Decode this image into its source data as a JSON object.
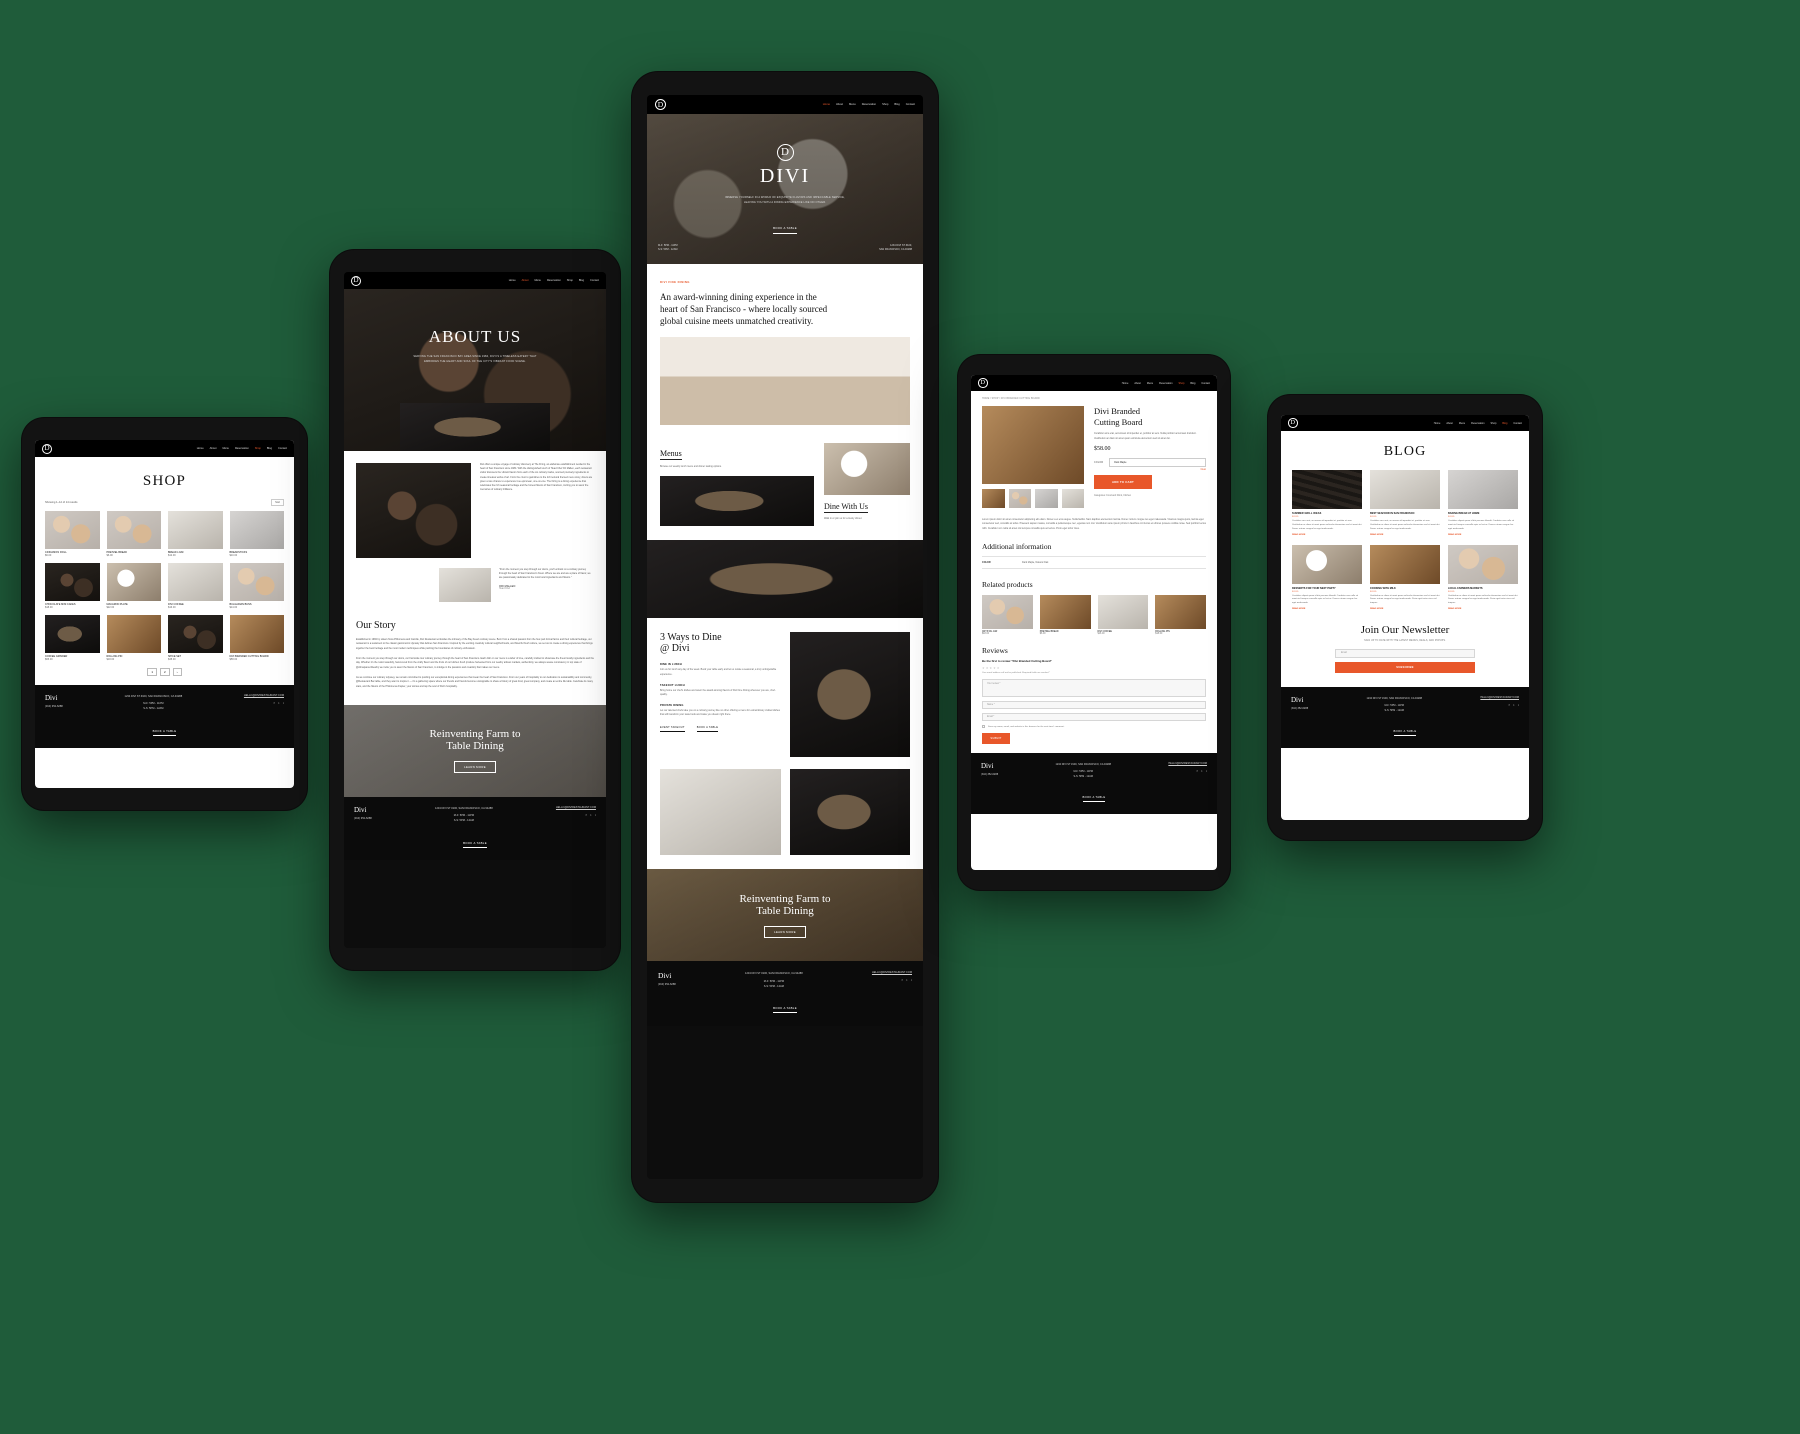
{
  "brand": {
    "name": "Divi",
    "logo_letter": "D"
  },
  "nav": {
    "items": [
      "Home",
      "About",
      "Menu",
      "Reservation",
      "Shop",
      "Blog",
      "Contact"
    ],
    "shop_caret": "Shop",
    "accent_color": "#e8572a"
  },
  "footer": {
    "brand": "Divi",
    "phone": "(310) 352-6288",
    "address": "1234 DIVI ST #100, SAN FRANCISCO, CA 94288",
    "hours_week": "M-F: 5PM - 11PM",
    "hours_weekend": "S-S: 5PM - 12AM",
    "email": "HELLO@DIVIRESTAURANT.COM",
    "book_label": "BOOK A TABLE",
    "socials": [
      "f",
      "t",
      "i"
    ]
  },
  "device_shop": {
    "page_title": "SHOP",
    "results_text": "Showing 1–12 of 14 results",
    "sort_label": "Sort",
    "products": [
      {
        "name": "CINNAMON ROLL",
        "price": "$6.00",
        "img": "ph-bread"
      },
      {
        "name": "PRETZEL BREAD",
        "price": "$6.00",
        "img": "ph-bread"
      },
      {
        "name": "BREAD LOAF",
        "price": "$12.00",
        "img": "ph-napkin"
      },
      {
        "name": "BREADSTICKS",
        "price": "$10.00",
        "img": "ph-stone"
      },
      {
        "name": "CHOCOLATE MINI CAKES",
        "price": "$18.00",
        "img": "ph-dark"
      },
      {
        "name": "MACARON PLATE",
        "price": "$22.00",
        "img": "ph-cream"
      },
      {
        "name": "DIVI COFFEE",
        "price": "$16.00",
        "img": "ph-napkin"
      },
      {
        "name": "BULGARIAN BUNS",
        "price": "$14.00",
        "img": "ph-bread"
      },
      {
        "name": "COFFEE GRINDER",
        "price": "$65.00",
        "img": "ph-pan"
      },
      {
        "name": "ROLLING PIN",
        "price": "$18.00",
        "img": "ph-wood"
      },
      {
        "name": "SPICE SET",
        "price": "$38.00",
        "img": "ph-dark"
      },
      {
        "name": "DIVI BRANDED CUTTING BOARD",
        "price": "$58.00",
        "img": "ph-wood"
      }
    ],
    "pagination": [
      "1",
      "2",
      "›"
    ]
  },
  "device_about": {
    "hero_title": "ABOUT US",
    "hero_sub_1": "SERVING THE SAN FRANCISCO BAY AREA SINCE 1984, DIVI IS A TIMELESS EATERY THAT",
    "hero_sub_2": "EMBODIES THE HEART AND SOUL OF THE CITY'S VIBRANT FOOD SCENE.",
    "intro_paragraph": "Divi offers a unique voyage of culinary discovery at The Firing, an elaborate establishment nestled in the heart of San Francisco since 1984. With the distinguished touch of Head Chef Ori Mallen, each restaurant visitor discovers the vibrant flavors from each of the six culinary tracks, sourced precisely ingredients to create timeless works of art. From the crust to garnishes to the rich textural themed menu story, diners are given a rare chance to experience true epicurean, one-on-one. The Firing is a dining experience that celebrates the rich seasonal heritage and the honest flavors of San Francisco, inviting you to savor the memories of culinary brilliance.",
    "quote": "\"From the moment you step through our doors, you'll embark on a culinary journey through the heart of San Francisco's finest. Where we are and are a place of flavor, we are passionately dedicated to the most local ingredients and flavors.\"",
    "quote_author": "ORI MALLEN",
    "quote_role": "Head Chef",
    "story_heading": "Our Story",
    "story_p1": "Established in 1984 by sisters Nora Philomena and Camille, Divi Restaurant embodies the intimacy of the Bay Area's culinary scene. Born from a shared passion from the four-part formal farms and their cultural heritage, our restaurant is a testament to the classic gastronomic dynasty that defines San Francisco. Inspired by the exciting creativity cultural neighborhoods, and flavorful fresh culture, we set out to create a dining experience that brings together the best heritage and the most modern techniques while pushing the boundaries of culinary enthusiasm.",
    "story_p2": "From the moment you step through our doors, our Farmside tour culinary journey through the heart of San Francisco. Each dish on our menu is a labor of love, carefully crafted to showcase the finest locally ingredients and the day. Whether it's the rustic tastefully, hand-cured from the crafty flavor and the fruits of our kitchen fresh produce harvested from our nearby artisan markets, authenticity, we always weave consistency in top state of @AlmaparoenNearby we invite you to savor the flavors of San Francisco, to indulge in the passions and creativity that makes our menu.",
    "story_p3": "As we continue our culinary odyssey, we remain committed to pushing our exceptional dining experiences that mean the heart of San Francisco. From our years of hospitality to our dedication to sustainability and community, @Restaurant Bar table, and they want to inspire it — it's a gathering space where our friends and friends become unstoppable to share a history of great food, great company, and create an entire life table. Celebrate its many stars, and the flavors of the Philomena chapter, your stories and tap the soul of Divi's hospitality.",
    "cta_title_l1": "Reinventing Farm to",
    "cta_title_l2": "Table Dining",
    "cta_button": "LEARN MORE"
  },
  "device_home": {
    "hero_logo_letter": "D",
    "hero_title": "DIVI",
    "hero_sub_1": "IMMERSE YOURSELF IN A WORLD OF EXQUISITE FLAVORS AND IMPECCABLE SERVICE,",
    "hero_sub_2": "LEAVING YOU WITH A DINING EXPERIENCE LIKE NO OTHER.",
    "hero_cta": "BOOK A TABLE",
    "hero_hours_1": "M-F: 5PM - 11PM",
    "hero_hours_2": "S-S: 5PM - 12AM",
    "hero_addr_1": "1234 DIVI ST #100,",
    "hero_addr_2": "SAN FRANCISCO, CA 94288",
    "eyebrow": "DIVI FINE DINING",
    "headline_l1": "An award-winning dining experience in the",
    "headline_l2": "heart of San Francisco - where locally sourced",
    "headline_l3": "global cuisine meets unmatched creativity.",
    "menus_heading": "Menus",
    "menus_sub": "Browse our weekly lunch menu and dinner tasting options.",
    "dine_heading": "Dine With Us",
    "dine_sub": "Walk in or join us for a lovely dinner.",
    "ways_heading_l1": "3 Ways to Dine",
    "ways_heading_l2": "@ Divi",
    "ways": [
      {
        "title": "DINE IN LUNCH",
        "body": "Join us for lunch any day of the week. Book your table early and let us curate a seasonal, a truly unforgettable experience."
      },
      {
        "title": "TAKEOUT LUNCH",
        "body": "Bring home our chef's dishes and savor the award-winning flavors of Divi Fine Dining wherever you are, chef-quality."
      },
      {
        "title": "PRIVATE DINING",
        "body": "Let our talented chefs take you on a culinary journey like no other offering a menu for extraordinary crafted dishes that will transform your taste buds and make you dream right there."
      }
    ],
    "ways_btn_1": "EVENT TAKEOUT",
    "ways_btn_2": "BOOK A TABLE",
    "cta_title_l1": "Reinventing Farm to",
    "cta_title_l2": "Table Dining",
    "cta_button": "LEARN MORE"
  },
  "device_product": {
    "breadcrumb": "HOME / SHOP / DIVI BRANDED CUTTING BOARD",
    "title_l1": "Divi Branded",
    "title_l2": "Cutting Board",
    "description": "Curabitur arcu erat, accumsan id imperdiet et, porttitor at sem. Nulla porttitor accumsan tincidunt. Vestibulum ac diam sit amet quam vehicula elementum sed sit amet dui.",
    "price": "$58.00",
    "price_currency": "$",
    "color_label": "COLOR",
    "color_value": "Dark Maple",
    "clear_label": "Clear",
    "add_to_cart": "ADD TO CART",
    "meta": "Categories: Food and Drink, Kitchen",
    "long_description": "Lorem ipsum dolor sit amet consectetur adipiscing elit etiam. Donec a et eros augue. Nulla facilisi. Nam dapibus elementum lacinia. Donec rutrum congue leo eget malesuada. Vivamus magna justo, lacinia eget consectetur sed, convallis at tellus. Praesent sapien massa, convallis a pellentesque nec, egestas non nisi. Vestibulum ante ipsum primis in faucibus orci luctus et ultrices posuere cubilia curae. Sed porttitor lectus nibh. Curabitur non nulla sit amet nisl tempus convallis quis ac lectus. Proin eget tortor risus.",
    "addl_heading": "Additional information",
    "addl_rows": [
      {
        "label": "COLOR",
        "value": "Dark Maple, Natural Oak"
      }
    ],
    "related_heading": "Related products",
    "related": [
      {
        "name": "CRYSTAL JAR",
        "price": "$18.00",
        "img": "ph-bread"
      },
      {
        "name": "PRETZEL BREAD",
        "price": "$6.00",
        "img": "ph-wood"
      },
      {
        "name": "DIVI COFFEE",
        "price": "$16.00",
        "img": "ph-napkin"
      },
      {
        "name": "ROLLING PIN",
        "price": "$18.00",
        "img": "ph-wood"
      }
    ],
    "reviews_heading": "Reviews",
    "reviews_sub": "Be the first to review \"Divi Branded Cutting Board\"",
    "reviews_note": "Your email address will not be published. Required fields are marked *",
    "field_review": "Your review *",
    "field_name": "Name *",
    "field_email": "Email *",
    "save_checkbox": "Save my name, email, and website in this browser for the next time I comment.",
    "submit_label": "SUBMIT",
    "thumbs": [
      "ph-wood",
      "ph-bread",
      "ph-stone",
      "ph-napkin"
    ]
  },
  "device_blog": {
    "page_title": "BLOG",
    "posts": [
      {
        "title": "SUMMER GRILL IDEAS",
        "cat": "FOOD",
        "body": "Curabitur arcu erat, accumsan id imperdiet et, porttitor at sem. Vestibulum ac diam sit amet quam vehicula elementum sed sit amet dui. Donec rutrum congue leo eget malesuada.",
        "more": "READ MORE",
        "img": "ph-grill"
      },
      {
        "title": "BEST SEAFOOD IN SAN FRANCISCO",
        "cat": "FOOD",
        "body": "Curabitur arcu erat, accumsan id imperdiet et, porttitor at sem. Vestibulum ac diam sit amet quam vehicula elementum sed sit amet dui. Donec rutrum congue leo eget malesuada.",
        "more": "READ MORE",
        "img": "ph-napkin"
      },
      {
        "title": "BAKING BREAD AT HOME",
        "cat": "FOOD",
        "body": "Curabitur aliquet quam id dui posuere blandit. Curabitur non nulla sit amet nisl tempus convallis quis ac lectus. Donec rutrum congue leo eget malesuada.",
        "more": "READ MORE",
        "img": "ph-stone"
      },
      {
        "title": "DESSERTS FOR YOUR NEXT PARTY",
        "cat": "FOOD",
        "body": "Curabitur aliquet quam id dui posuere blandit. Curabitur non nulla sit amet nisl tempus convallis quis ac lectus. Donec rutrum congue leo eget malesuada.",
        "more": "READ MORE",
        "img": "ph-cream"
      },
      {
        "title": "COOKING WITH MILK",
        "cat": "FOOD",
        "body": "Vestibulum ac diam sit amet quam vehicula elementum sed sit amet dui. Donec rutrum congue leo eget malesuada. Proin eget tortor risus nisl tempus.",
        "more": "READ MORE",
        "img": "ph-bread"
      },
      {
        "title": "LOCAL FARMERS MARKETS",
        "cat": "FOOD",
        "body": "Vestibulum ac diam sit amet quam vehicula elementum sed sit amet dui. Donec rutrum congue leo eget malesuada. Proin eget tortor risus nisl tempus.",
        "more": "READ MORE",
        "img": "ph-bread"
      }
    ],
    "newsletter_heading": "Join Our Newsletter",
    "newsletter_sub": "SIGN UP TO DATE WITH THE LATEST MENUS, DEALS, AND POPUPS.",
    "newsletter_placeholder": "Email",
    "newsletter_button": "SUBSCRIBE"
  }
}
